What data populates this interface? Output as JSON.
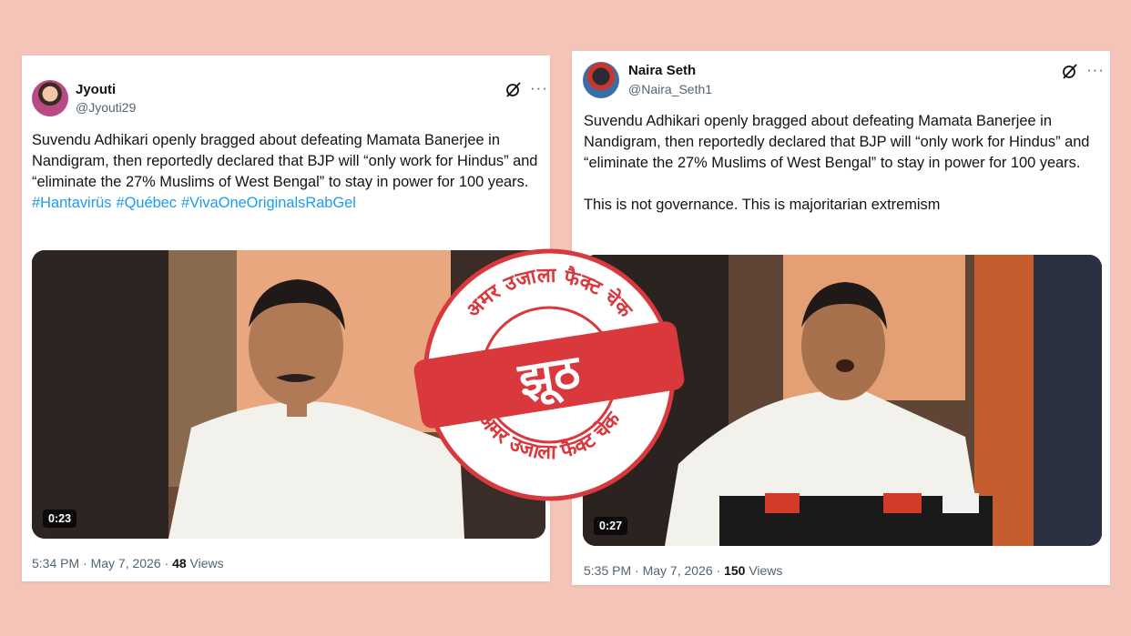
{
  "tweets": [
    {
      "author": "Jyouti",
      "handle": "@Jyouti29",
      "text": "Suvendu Adhikari openly bragged about defeating Mamata Banerjee in Nandigram, then reportedly declared that BJP will “only work for Hindus” and “eliminate the 27% Muslims of West Bengal” to stay in power for 100 years.",
      "hashtags": [
        "#Hantavirüs",
        "#Québec",
        "#VivaOneOriginalsRabGel"
      ],
      "video_duration": "0:23",
      "timestamp": "5:34 PM · May 7, 2026 ·",
      "views_count": "48",
      "views_label": "Views"
    },
    {
      "author": "Naira Seth",
      "handle": "@Naira_Seth1",
      "text": "Suvendu Adhikari openly bragged about defeating Mamata Banerjee in Nandigram, then reportedly declared that BJP will “only work for Hindus” and “eliminate the 27% Muslims of West Bengal” to stay in power for 100 years.",
      "text2": "This is not governance. This is majoritarian extremism",
      "video_duration": "0:27",
      "timestamp": "5:35 PM · May 7, 2026 ·",
      "views_count": "150",
      "views_label": "Views"
    }
  ],
  "stamp": {
    "ring_text": "अमर उजाला फैक्ट चेक",
    "verdict": "झूठ"
  },
  "colors": {
    "background": "#f5c4b8",
    "stamp_red": "#d9383d",
    "hashtag_blue": "#1d9bf0"
  },
  "icons": [
    "grok-icon",
    "more-icon"
  ]
}
